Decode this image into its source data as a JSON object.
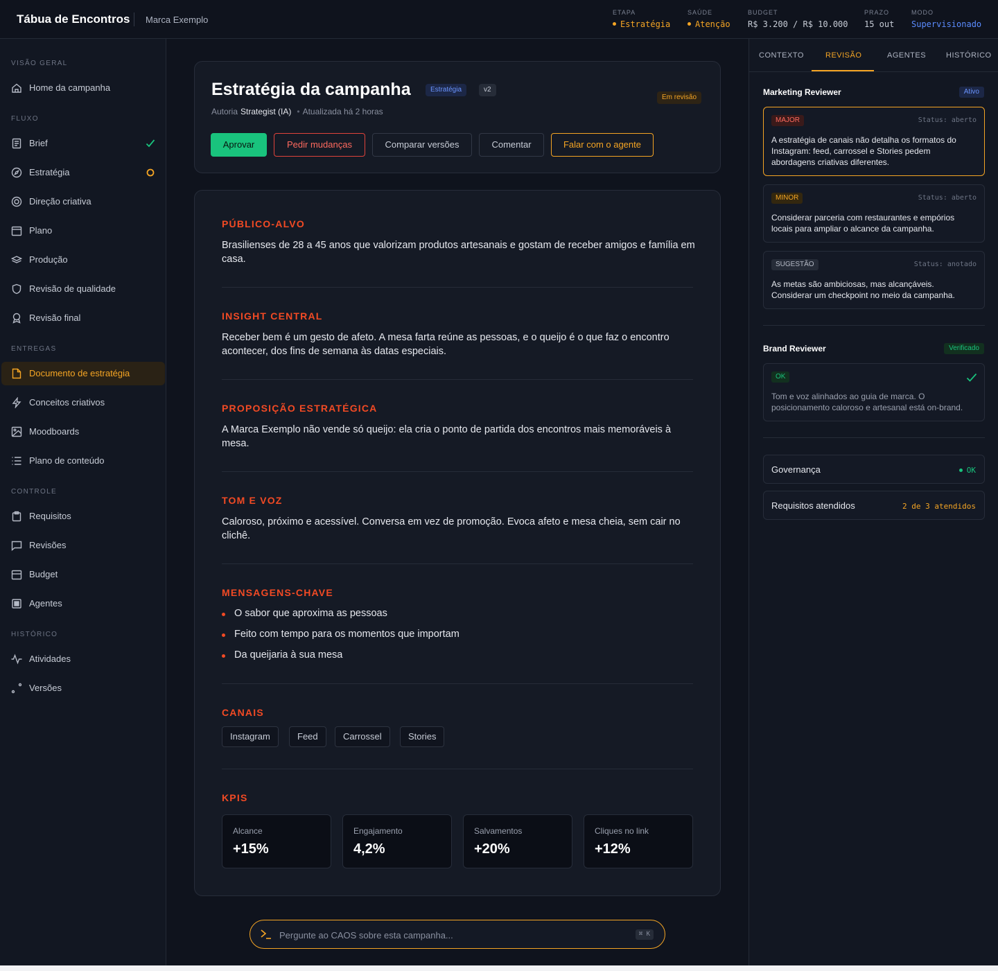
{
  "header": {
    "app_title": "Tábua de Encontros",
    "brand": "Marca Exemplo",
    "stats": [
      {
        "label": "ETAPA",
        "value": "Estratégia",
        "color": "#f5a524"
      },
      {
        "label": "SAÚDE",
        "value": "Atenção",
        "color": "#f5a524"
      },
      {
        "label": "BUDGET",
        "value": "R$ 3.200 / R$ 10.000",
        "color": "#c7ccd6"
      },
      {
        "label": "PRAZO",
        "value": "15 out",
        "color": "#c7ccd6"
      },
      {
        "label": "MODO",
        "value": "Supervisionado",
        "color": "#5b8cff"
      }
    ]
  },
  "sidebar": {
    "sections": [
      {
        "title": "VISÃO GERAL"
      },
      {
        "title": "FLUXO"
      },
      {
        "title": "ENTREGAS"
      },
      {
        "title": "CONTROLE"
      },
      {
        "title": "HISTÓRICO"
      }
    ],
    "items": [
      {
        "label": "Home da campanha",
        "icon": "home-icon"
      },
      {
        "label": "Brief",
        "icon": "document-icon",
        "status": "done"
      },
      {
        "label": "Estratégia",
        "icon": "compass-icon",
        "status": "in-progress"
      },
      {
        "label": "Direção criativa",
        "icon": "target-icon"
      },
      {
        "label": "Plano",
        "icon": "calendar-icon"
      },
      {
        "label": "Produção",
        "icon": "layers-icon"
      },
      {
        "label": "Revisão de qualidade",
        "icon": "shield-icon"
      },
      {
        "label": "Revisão final",
        "icon": "award-icon"
      },
      {
        "label": "Documento de estratégia",
        "icon": "file-icon",
        "active": true
      },
      {
        "label": "Conceitos criativos",
        "icon": "bolt-icon"
      },
      {
        "label": "Moodboards",
        "icon": "image-icon"
      },
      {
        "label": "Plano de conteúdo",
        "icon": "list-icon"
      },
      {
        "label": "Requisitos",
        "icon": "clipboard-icon"
      },
      {
        "label": "Revisões",
        "icon": "message-icon"
      },
      {
        "label": "Budget",
        "icon": "wallet-icon"
      },
      {
        "label": "Agentes",
        "icon": "chip-icon"
      },
      {
        "label": "Atividades",
        "icon": "activity-icon"
      },
      {
        "label": "Versões",
        "icon": "branch-icon"
      }
    ]
  },
  "doc": {
    "title": "Estratégia da campanha",
    "stage_tag": "Estratégia",
    "version_tag": "v2",
    "status_tag": "Em revisão",
    "meta_author_label": "Autoria",
    "meta_author": "Strategist (IA)",
    "meta_updated": "Atualizada há 2 horas",
    "actions": {
      "approve": "Aprovar",
      "request_changes": "Pedir mudanças",
      "compare": "Comparar versões",
      "comment": "Comentar",
      "talk_agent": "Falar com o agente"
    },
    "sections": {
      "audience": {
        "title": "PÚBLICO-ALVO",
        "text": "Brasilienses de 28 a 45 anos que valorizam produtos artesanais e gostam de receber amigos e família em casa."
      },
      "insight": {
        "title": "INSIGHT CENTRAL",
        "text": "Receber bem é um gesto de afeto. A mesa farta reúne as pessoas, e o queijo é o que faz o encontro acontecer, dos fins de semana às datas especiais."
      },
      "proposition": {
        "title": "PROPOSIÇÃO ESTRATÉGICA",
        "text": "A Marca Exemplo não vende só queijo: ela cria o ponto de partida dos encontros mais memoráveis à mesa."
      },
      "tone": {
        "title": "TOM E VOZ",
        "text": "Caloroso, próximo e acessível. Conversa em vez de promoção. Evoca afeto e mesa cheia, sem cair no clichê."
      },
      "messages": {
        "title": "MENSAGENS-CHAVE",
        "items": [
          "O sabor que aproxima as pessoas",
          "Feito com tempo para os momentos que importam",
          "Da queijaria à sua mesa"
        ]
      },
      "channels": {
        "title": "CANAIS",
        "items": [
          "Instagram",
          "Feed",
          "Carrossel",
          "Stories"
        ]
      },
      "kpis": {
        "title": "KPIS",
        "items": [
          {
            "label": "Alcance",
            "value": "+15%"
          },
          {
            "label": "Engajamento",
            "value": "4,2%"
          },
          {
            "label": "Salvamentos",
            "value": "+20%"
          },
          {
            "label": "Cliques no link",
            "value": "+12%"
          }
        ]
      }
    }
  },
  "ask": {
    "placeholder": "Pergunte ao CAOS sobre esta campanha...",
    "shortcut": "⌘ K"
  },
  "panel": {
    "tabs": [
      "CONTEXTO",
      "REVISÃO",
      "AGENTES",
      "HISTÓRICO"
    ],
    "active_tab": "REVISÃO",
    "marketing": {
      "title": "Marketing Reviewer",
      "badge": "Ativo",
      "items": [
        {
          "severity": "MAJOR",
          "status": "Status: aberto",
          "text": "A estratégia de canais não detalha os formatos do Instagram: feed, carrossel e Stories pedem abordagens criativas diferentes."
        },
        {
          "severity": "MINOR",
          "status": "Status: aberto",
          "text": "Considerar parceria com restaurantes e empórios locais para ampliar o alcance da campanha."
        },
        {
          "severity": "SUGESTÃO",
          "status": "Status: anotado",
          "text": "As metas são ambiciosas, mas alcançáveis. Considerar um checkpoint no meio da campanha."
        }
      ]
    },
    "brand": {
      "title": "Brand Reviewer",
      "badge": "Verificado",
      "item": {
        "severity": "OK",
        "text": "Tom e voz alinhados ao guia de marca. O posicionamento caloroso e artesanal está on-brand."
      }
    },
    "governance": {
      "label": "Governança",
      "value": "OK"
    },
    "requirements": {
      "label": "Requisitos atendidos",
      "value": "2 de 3 atendidos"
    }
  },
  "colors": {
    "accent": "#f5a524",
    "danger": "#f24a24",
    "success": "#19c37d",
    "info": "#5b8cff"
  }
}
